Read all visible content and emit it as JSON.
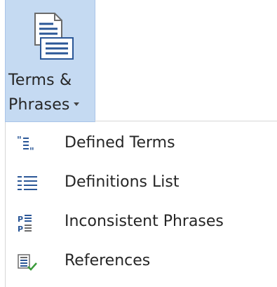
{
  "ribbon": {
    "button": {
      "label_line1": "Terms &",
      "label_line2": "Phrases",
      "icon": "terms-document-icon",
      "has_dropdown": true
    }
  },
  "menu": {
    "items": [
      {
        "label": "Defined Terms",
        "icon": "quote-list-icon"
      },
      {
        "label": "Definitions List",
        "icon": "list-icon"
      },
      {
        "label": "Inconsistent Phrases",
        "icon": "phrase-compare-icon"
      },
      {
        "label": "References",
        "icon": "reference-check-icon"
      }
    ]
  },
  "colors": {
    "button_highlight": "#c5daf2",
    "icon_blue": "#2b5797",
    "icon_green": "#3a9b3a"
  }
}
